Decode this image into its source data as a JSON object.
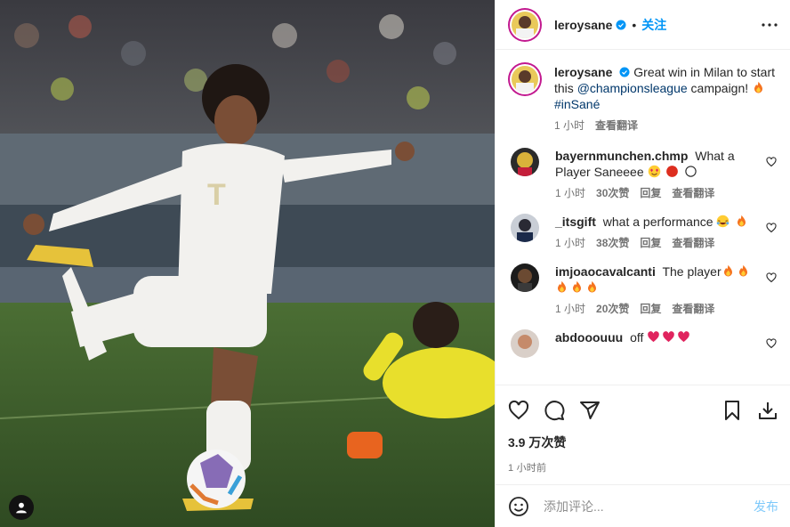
{
  "post": {
    "author": "leroysane",
    "follow_label": "关注",
    "dot": "•"
  },
  "caption": {
    "username": "leroysane",
    "text_before": "Great win in Milan to start this",
    "mention": "@championsleague",
    "text_after": "campaign!",
    "hashtag": "#inSané",
    "time": "1 小时",
    "translate": "查看翻译"
  },
  "comments": [
    {
      "username": "bayernmunchen.chmp",
      "text": "What a Player Saneeee",
      "emojis": [
        "heart-eyes-emoji",
        "red-circle-emoji",
        "white-circle-emoji"
      ],
      "time": "1 小时",
      "likes": "30次赞",
      "reply": "回复",
      "translate": "查看翻译"
    },
    {
      "username": "_itsgift",
      "text": "what a performance",
      "emojis": [
        "crying-laughing-emoji",
        "fire-emoji"
      ],
      "time": "1 小时",
      "likes": "38次赞",
      "reply": "回复",
      "translate": "查看翻译"
    },
    {
      "username": "imjoaocavalcanti",
      "text": "The player",
      "emojis": [
        "fire-emoji",
        "fire-emoji",
        "fire-emoji",
        "fire-emoji",
        "fire-emoji"
      ],
      "time": "1 小时",
      "likes": "20次赞",
      "reply": "回复",
      "translate": "查看翻译"
    },
    {
      "username": "abdooouuu",
      "text": "off",
      "emojis": [
        "heart-emoji",
        "heart-emoji",
        "heart-emoji"
      ]
    }
  ],
  "stats": {
    "likes": "3.9 万次赞",
    "time": "1 小时前"
  },
  "composer": {
    "placeholder": "添加评论...",
    "post_label": "发布"
  },
  "colors": {
    "accent": "#0095f6",
    "verified": "#0095f6",
    "mention": "#00376b",
    "muted": "#737373",
    "border": "#efefef"
  }
}
